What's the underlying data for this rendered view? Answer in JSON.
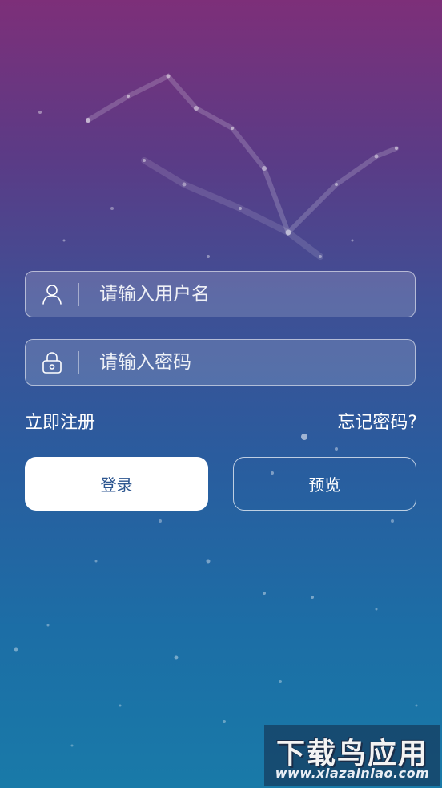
{
  "login_form": {
    "username_placeholder": "请输入用户名",
    "password_placeholder": "请输入密码",
    "register_label": "立即注册",
    "forgot_password_label": "忘记密码?",
    "login_button_label": "登录",
    "preview_button_label": "预览"
  },
  "icons": {
    "username": "user-icon",
    "password": "lock-icon"
  },
  "watermark": {
    "title": "下载鸟应用",
    "url": "www.xiazainiao.com"
  },
  "colors": {
    "background_top": "#7d2f79",
    "background_bottom": "#197aa8",
    "login_button_text": "#2d5690"
  }
}
